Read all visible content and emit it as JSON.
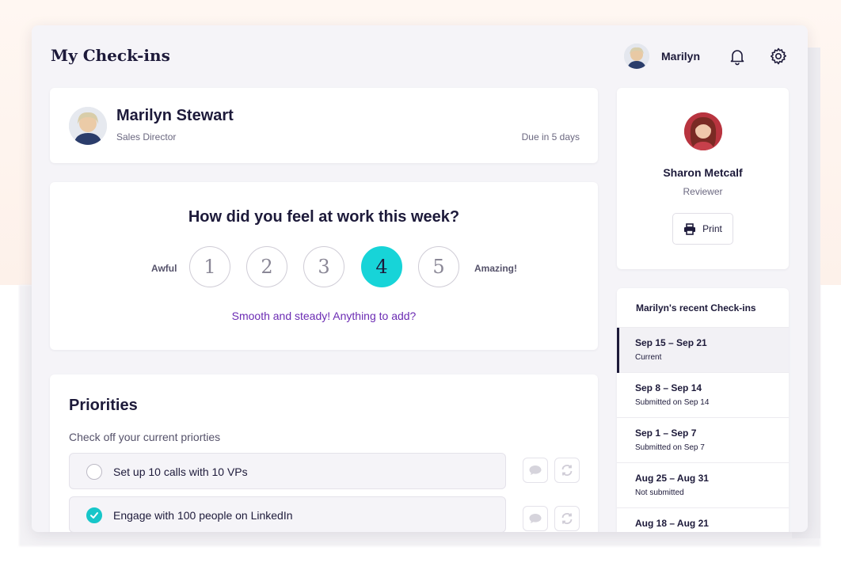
{
  "header": {
    "title": "My Check-ins",
    "user_name": "Marilyn"
  },
  "profile": {
    "name": "Marilyn Stewart",
    "role": "Sales Director",
    "due": "Due in 5 days"
  },
  "mood": {
    "question": "How did you feel at work this week?",
    "low_label": "Awful",
    "high_label": "Amazing!",
    "options": [
      "1",
      "2",
      "3",
      "4",
      "5"
    ],
    "selected": "4",
    "feedback": "Smooth and steady! Anything to add?",
    "accent_color": "#17d4d8"
  },
  "priorities": {
    "title": "Priorities",
    "subtitle": "Check off your current priorties",
    "items": [
      {
        "text": "Set up 10 calls with 10 VPs",
        "done": false
      },
      {
        "text": "Engage with 100 people on LinkedIn",
        "done": true
      }
    ]
  },
  "reviewer": {
    "name": "Sharon Metcalf",
    "role": "Reviewer",
    "print_label": "Print"
  },
  "history": {
    "title": "Marilyn's recent Check-ins",
    "items": [
      {
        "range": "Sep 15 – Sep 21",
        "status": "Current"
      },
      {
        "range": "Sep 8 – Sep 14",
        "status": "Submitted on Sep 14"
      },
      {
        "range": "Sep 1 – Sep 7",
        "status": "Submitted on Sep 7"
      },
      {
        "range": "Aug 25 – Aug 31",
        "status": "Not submitted"
      },
      {
        "range": "Aug 18 – Aug 21",
        "status": ""
      }
    ]
  }
}
